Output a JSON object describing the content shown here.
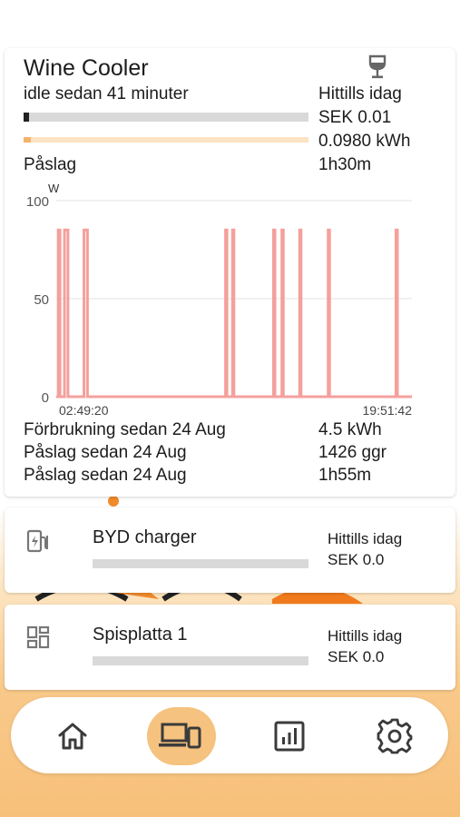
{
  "wine_cooler": {
    "title": "Wine Cooler",
    "icon": "wine-glass-icon",
    "status": "idle sedan 41 minuter",
    "today_label": "Hittills idag",
    "cost": "SEK 0.01",
    "energy": "0.0980 kWh",
    "on_label": "Påslag",
    "on_time": "1h30m",
    "cost_bar_fraction": 0.02,
    "energy_bar_fraction": 0.025,
    "stats": [
      {
        "label": "Förbrukning sedan  24 Aug",
        "value": "4.5 kWh"
      },
      {
        "label": "Påslag sedan  24 Aug",
        "value": "1426 ggr"
      },
      {
        "label": "Påslag sedan  24 Aug",
        "value": "1h55m"
      }
    ]
  },
  "chart_data": {
    "type": "line",
    "ylabel": "W",
    "ylim": [
      0,
      100
    ],
    "y_ticks": [
      "100",
      "50",
      "0"
    ],
    "x_start_label": "02:49:20",
    "x_end_label": "19:51:42",
    "x_start": "02:49:20",
    "x_end": "19:51:42",
    "grid": true,
    "color": "#f4a09c",
    "pulses": [
      {
        "start": "02:55",
        "end": "03:00",
        "value": 85
      },
      {
        "start": "03:13",
        "end": "03:23",
        "value": 85
      },
      {
        "start": "04:09",
        "end": "04:19",
        "value": 85
      },
      {
        "start": "10:56",
        "end": "11:00",
        "value": 85
      },
      {
        "start": "11:16",
        "end": "11:20",
        "value": 85
      },
      {
        "start": "13:14",
        "end": "13:18",
        "value": 85
      },
      {
        "start": "13:38",
        "end": "13:42",
        "value": 85
      },
      {
        "start": "14:29",
        "end": "14:33",
        "value": 85
      },
      {
        "start": "15:51",
        "end": "15:55",
        "value": 85
      },
      {
        "start": "19:06",
        "end": "19:10",
        "value": 85
      }
    ]
  },
  "devices": [
    {
      "name": "BYD charger",
      "icon": "ev-charger-icon",
      "today_label": "Hittills idag",
      "cost": "SEK 0.0",
      "bar_fraction": 0
    },
    {
      "name": "Spisplatta 1",
      "icon": "dashboard-grid-icon",
      "today_label": "Hittills idag",
      "cost": "SEK 0.0",
      "bar_fraction": 0
    }
  ],
  "nav": [
    {
      "icon": "home-icon",
      "active": false
    },
    {
      "icon": "devices-icon",
      "active": true
    },
    {
      "icon": "statistics-icon",
      "active": false
    },
    {
      "icon": "settings-icon",
      "active": false
    }
  ],
  "colors": {
    "accent": "#f7c07a",
    "active_nav": "#f5c27f",
    "chart_line": "#f4a09c",
    "energy_bar": "#fbe3c4"
  }
}
